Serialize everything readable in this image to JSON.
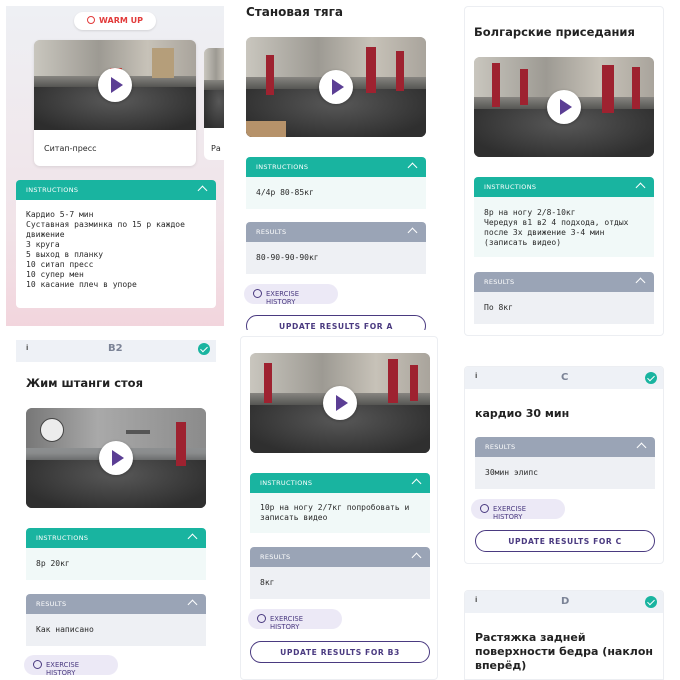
{
  "warmup": {
    "badge": "WARM UP",
    "carousel": [
      {
        "label": "Ситап-пресс"
      },
      {
        "label": "Ра"
      }
    ],
    "instructions_header": "INSTRUCTIONS",
    "instructions_lines": [
      "Кардио 5-7 мин",
      "Суставная разминка по 15 р каждое",
      "движение",
      "3 круга",
      "5 выход в планку",
      "10 ситап пресс",
      "10 супер мен",
      "10 касание плеч в упоре"
    ]
  },
  "deadlift": {
    "title": "Становая тяга",
    "instructions_header": "INSTRUCTIONS",
    "instructions": "4/4р 80-85кг",
    "results_header": "RESULTS",
    "results": "80-90-90-90кг",
    "history": "EXERCISE HISTORY",
    "update": "UPDATE RESULTS FOR A"
  },
  "bulgarian": {
    "title": "Болгарские приседания",
    "instructions_header": "INSTRUCTIONS",
    "instructions_lines": [
      "8р на ногу 2/8-10кг",
      "Чередуя в1 в2 4 подхода, отдых",
      "после 3х движение 3-4 мин",
      "(записать видео)"
    ],
    "results_header": "RESULTS",
    "results": "По 8кг"
  },
  "b2": {
    "info": "i",
    "letter": "B2",
    "title": "Жим штанги стоя",
    "instructions_header": "INSTRUCTIONS",
    "instructions": "8р 20кг",
    "results_header": "RESULTS",
    "results": "Как написано",
    "history": "EXERCISE HISTORY"
  },
  "b3": {
    "instructions_header": "INSTRUCTIONS",
    "instructions_lines": [
      "10р на ногу 2/7кг попробовать и",
      "записать видео"
    ],
    "results_header": "RESULTS",
    "results": "8кг",
    "history": "EXERCISE HISTORY",
    "update": "UPDATE RESULTS FOR B3"
  },
  "c": {
    "info": "i",
    "letter": "C",
    "title": "кардио 30 мин",
    "results_header": "RESULTS",
    "results": "30мин элипс",
    "history": "EXERCISE HISTORY",
    "update": "UPDATE RESULTS FOR C"
  },
  "d": {
    "info": "i",
    "letter": "D",
    "title_lines": [
      "Растяжка задней",
      "поверхности бедра (наклон",
      "вперёд)"
    ]
  },
  "colors": {
    "teal": "#19b4a0",
    "slate": "#9aa4b6",
    "purple": "#4a3a80",
    "warmup": "#e23b3b"
  }
}
